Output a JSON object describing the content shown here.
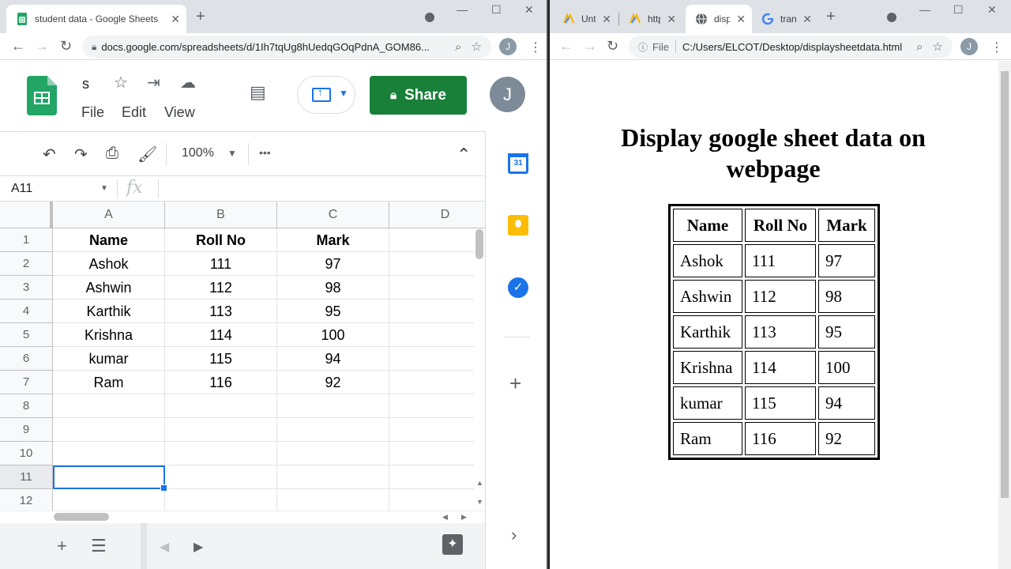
{
  "left_window": {
    "tab_title": "student data - Google Sheets",
    "url": "docs.google.com/spreadsheets/d/1Ih7tqUg8hUedqGOqPdnA_GOM86...",
    "profile_initial": "J",
    "doc_title": "s",
    "menus": [
      "File",
      "Edit",
      "View"
    ],
    "share_label": "Share",
    "account_initial": "J",
    "zoom": "100%",
    "more_label": "•••",
    "name_box": "A11",
    "fx_label": "fx",
    "columns": [
      "A",
      "B",
      "C",
      "D"
    ],
    "rows": [
      "1",
      "2",
      "3",
      "4",
      "5",
      "6",
      "7",
      "8",
      "9",
      "10",
      "11",
      "12"
    ],
    "cells": [
      [
        "Name",
        "Roll No",
        "Mark"
      ],
      [
        "Ashok",
        "111",
        "97"
      ],
      [
        "Ashwin",
        "112",
        "98"
      ],
      [
        "Karthik",
        "113",
        "95"
      ],
      [
        "Krishna",
        "114",
        "100"
      ],
      [
        "kumar",
        "115",
        "94"
      ],
      [
        "Ram",
        "116",
        "92"
      ]
    ],
    "calendar_day": "31"
  },
  "right_window": {
    "tabs": [
      "Untit",
      "http:",
      "displ",
      "tran"
    ],
    "scheme_label": "File",
    "url": "C:/Users/ELCOT/Desktop/displaysheetdata.html",
    "profile_initial": "J",
    "page_title": "Display google sheet data on webpage",
    "table_headers": [
      "Name",
      "Roll No",
      "Mark"
    ],
    "table_rows": [
      [
        "Ashok",
        "111",
        "97"
      ],
      [
        "Ashwin",
        "112",
        "98"
      ],
      [
        "Karthik",
        "113",
        "95"
      ],
      [
        "Krishna",
        "114",
        "100"
      ],
      [
        "kumar",
        "115",
        "94"
      ],
      [
        "Ram",
        "116",
        "92"
      ]
    ]
  },
  "colors": {
    "share_green": "#188038",
    "sheets_green": "#23a566",
    "selection_blue": "#1a73e8"
  }
}
